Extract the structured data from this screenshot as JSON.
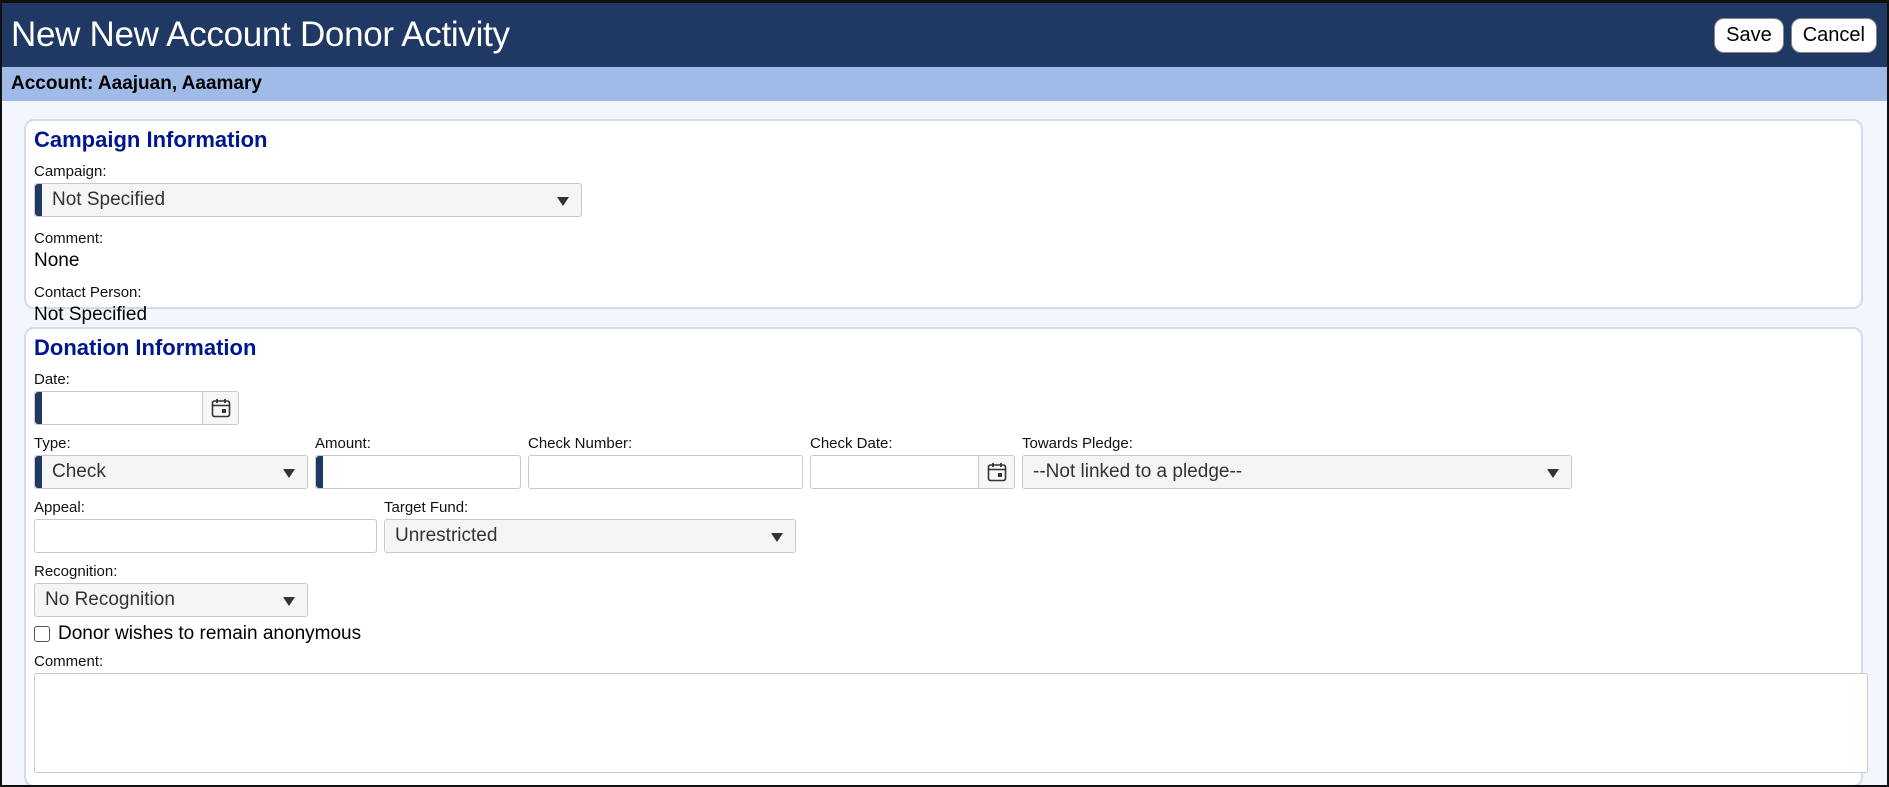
{
  "header": {
    "title": "New New Account Donor Activity",
    "save_label": "Save",
    "cancel_label": "Cancel"
  },
  "account_bar": {
    "text": "Account: Aaajuan, Aaamary"
  },
  "campaign_section": {
    "title": "Campaign Information",
    "campaign_label": "Campaign:",
    "campaign_value": "Not Specified",
    "comment_label": "Comment:",
    "comment_value": "None",
    "contact_label": "Contact Person:",
    "contact_value": "Not Specified"
  },
  "donation_section": {
    "title": "Donation Information",
    "date_label": "Date:",
    "type_label": "Type:",
    "type_value": "Check",
    "amount_label": "Amount:",
    "check_number_label": "Check Number:",
    "check_date_label": "Check Date:",
    "pledge_label": "Towards Pledge:",
    "pledge_value": "--Not linked to a pledge--",
    "appeal_label": "Appeal:",
    "target_fund_label": "Target Fund:",
    "target_fund_value": "Unrestricted",
    "recognition_label": "Recognition:",
    "recognition_value": "No Recognition",
    "anonymous_label": "Donor wishes to remain anonymous",
    "comment_label": "Comment:"
  },
  "colors": {
    "header_bg": "#1f3864",
    "account_bar_bg": "#a0bbe8",
    "section_title": "#00168c",
    "required_marker": "#1f3864"
  },
  "icons": {
    "calendar": "calendar-icon",
    "dropdown": "chevron-down-icon"
  }
}
